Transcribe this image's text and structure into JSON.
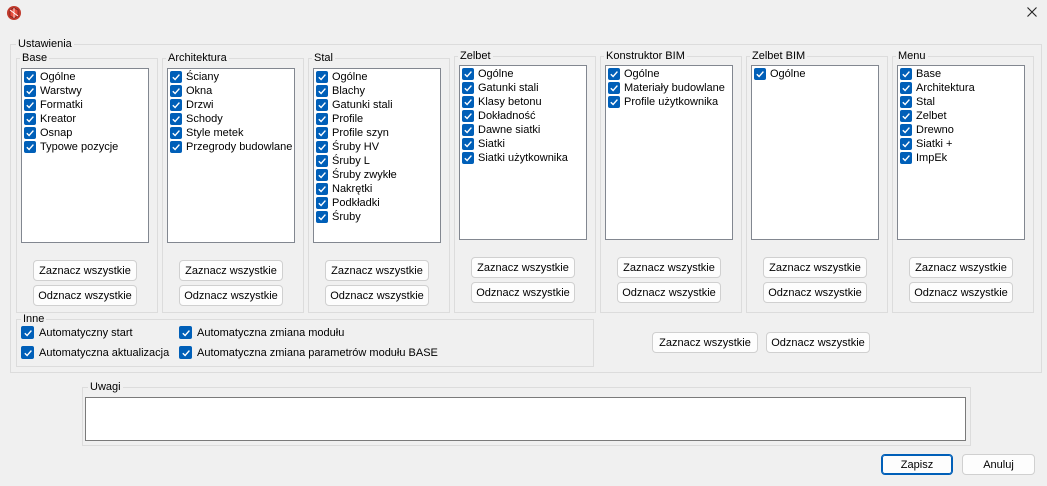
{
  "window": {
    "close_icon": "close-icon",
    "app_icon": "app-logo-icon"
  },
  "settings": {
    "title": "Ustawienia",
    "groups": [
      {
        "title": "Base",
        "items": [
          "Ogólne",
          "Warstwy",
          "Formatki",
          "Kreator",
          "Osnap",
          "Typowe pozycje"
        ]
      },
      {
        "title": "Architektura",
        "items": [
          "Ściany",
          "Okna",
          "Drzwi",
          "Schody",
          "Style metek",
          "Przegrody budowlane"
        ]
      },
      {
        "title": "Stal",
        "items": [
          "Ogólne",
          "Blachy",
          "Gatunki stali",
          "Profile",
          "Profile szyn",
          "Śruby HV",
          "Śruby L",
          "Śruby zwykłe",
          "Nakrętki",
          "Podkładki",
          "Śruby"
        ]
      },
      {
        "title": "Zelbet",
        "items": [
          "Ogólne",
          "Gatunki stali",
          "Klasy betonu",
          "Dokładność",
          "Dawne siatki",
          "Siatki",
          "Siatki użytkownika"
        ]
      },
      {
        "title": "Konstruktor BIM",
        "items": [
          "Ogólne",
          "Materiały budowlane",
          "Profile użytkownika"
        ]
      },
      {
        "title": "Zelbet BIM",
        "items": [
          "Ogólne"
        ]
      },
      {
        "title": "Menu",
        "items": [
          "Base",
          "Architektura",
          "Stal",
          "Zelbet",
          "Drewno",
          "Siatki +",
          "ImpEk"
        ]
      }
    ],
    "select_all_label": "Zaznacz wszystkie",
    "deselect_all_label": "Odznacz wszystkie"
  },
  "inne": {
    "title": "Inne",
    "auto_start": "Automatyczny start",
    "auto_update": "Automatyczna aktualizacja",
    "auto_module_change": "Automatyczna zmiana modułu",
    "auto_base_params": "Automatyczna zmiana parametrów modułu BASE"
  },
  "global_buttons": {
    "select_all": "Zaznacz wszystkie",
    "deselect_all": "Odznacz wszystkie"
  },
  "notes": {
    "title": "Uwagi",
    "value": ""
  },
  "footer": {
    "save": "Zapisz",
    "cancel": "Anuluj"
  },
  "colors": {
    "accent": "#005fb8",
    "background": "#f0f0f0"
  }
}
